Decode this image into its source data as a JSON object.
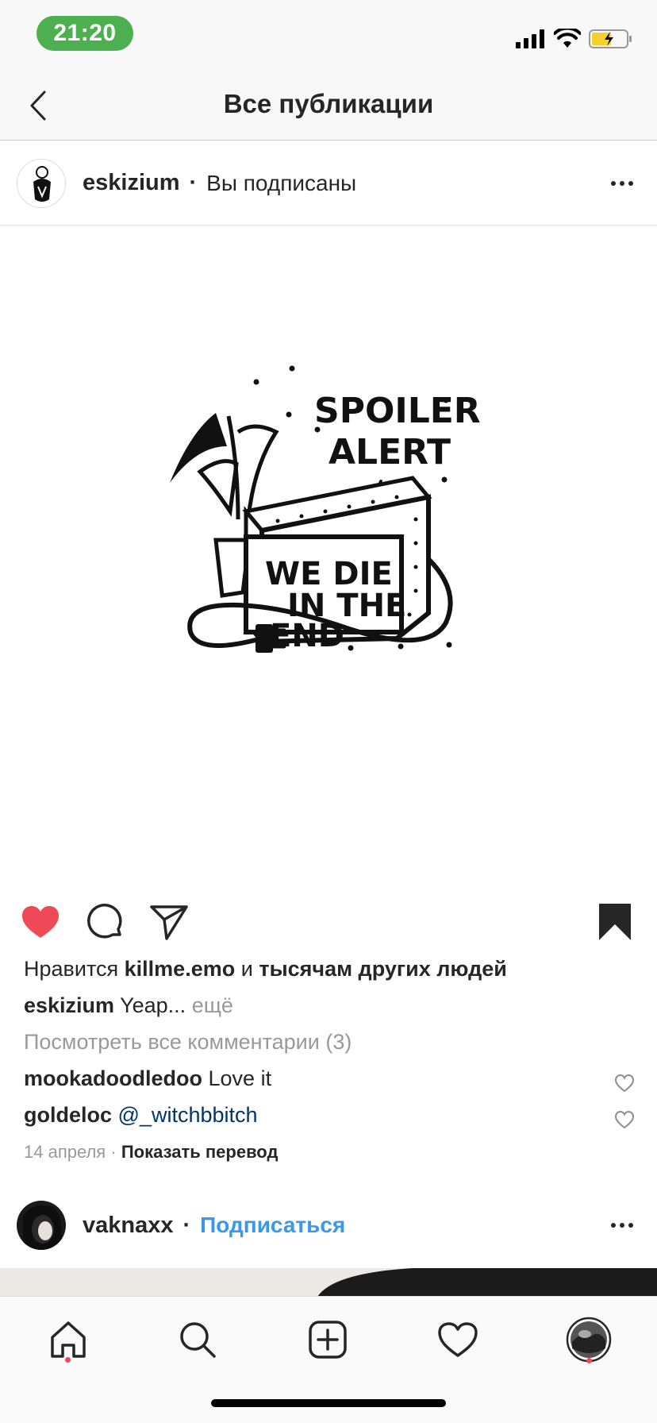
{
  "status_bar": {
    "time": "21:20",
    "time_pill_color": "#4caf50",
    "icons": [
      "signal-icon",
      "wifi-icon",
      "battery-charging-icon"
    ]
  },
  "nav": {
    "title": "Все публикации",
    "back_icon": "chevron-left-icon"
  },
  "post": {
    "username": "eskizium",
    "follow_state": "Вы подписаны",
    "image_text": {
      "line1": "SPOILER",
      "line2": "ALERT",
      "line3": "WE DIE",
      "line4": "IN THE",
      "line5": "END"
    },
    "liked": true,
    "saved": true,
    "likes": {
      "prefix": "Нравится",
      "user": "killme.emo",
      "conj": "и",
      "rest": "тысячам других людей"
    },
    "caption": {
      "user": "eskizium",
      "text": "Yeap...",
      "more": "ещё"
    },
    "view_comments": "Посмотреть все комментарии (3)",
    "comments": [
      {
        "user": "mookadoodledoo",
        "text": "Love it"
      },
      {
        "user": "goldeloc",
        "mention": "@_witchbbitch"
      }
    ],
    "date": "14 апреля",
    "translate": "Показать перевод"
  },
  "next_post": {
    "username": "vaknaxx",
    "follow_label": "Подписаться"
  },
  "colors": {
    "heart": "#ed4956",
    "link_blue": "#3897f0",
    "mention": "#003569",
    "muted": "#999999"
  },
  "tab_bar": {
    "tabs": [
      "home-icon",
      "search-icon",
      "new-post-icon",
      "activity-heart-icon",
      "profile-avatar"
    ]
  }
}
